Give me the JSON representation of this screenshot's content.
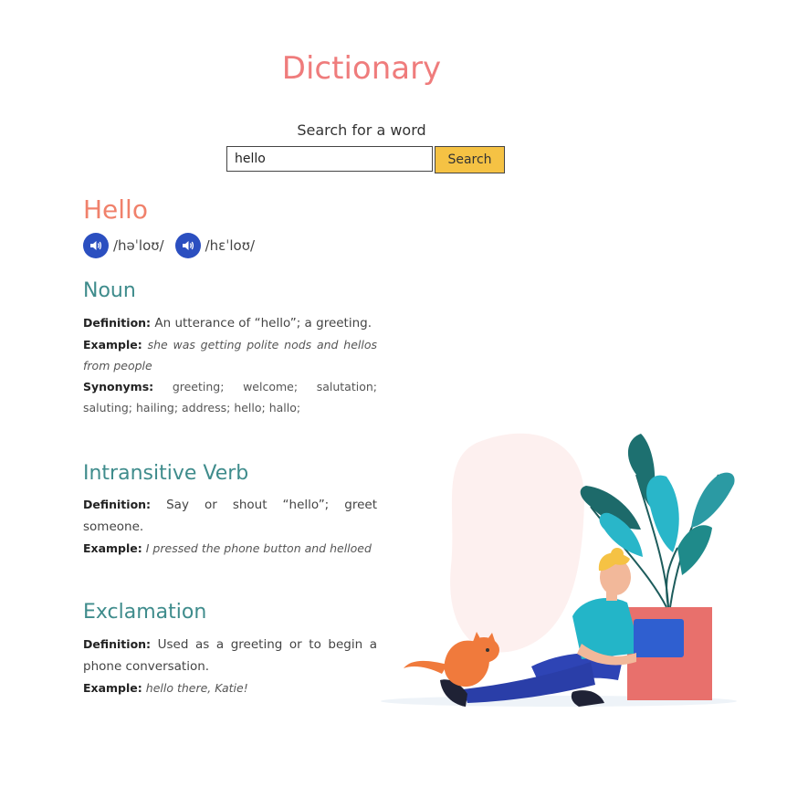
{
  "header": {
    "title": "Dictionary"
  },
  "search": {
    "prompt": "Search for a word",
    "value": "hello",
    "button_label": "Search"
  },
  "result": {
    "word": "Hello",
    "phonetics": [
      {
        "text": "/həˈloʊ/"
      },
      {
        "text": "/hɛˈloʊ/"
      }
    ],
    "meanings": [
      {
        "part_of_speech": "Noun",
        "definition_label": "Definition:",
        "definition": "An utterance of “hello”; a greeting.",
        "example_label": "Example:",
        "example": "she was getting polite nods and hellos from people",
        "synonyms_label": "Synonyms:",
        "synonyms": "greeting;  welcome;  salutation;  saluting;  hailing;  address;  hello;  hallo;"
      },
      {
        "part_of_speech": "Intransitive Verb",
        "definition_label": "Definition:",
        "definition": "Say or shout “hello”; greet someone.",
        "example_label": "Example:",
        "example": "I pressed the phone button and helloed"
      },
      {
        "part_of_speech": "Exclamation",
        "definition_label": "Definition:",
        "definition": "Used as a greeting or to begin a phone conversation.",
        "example_label": "Example:",
        "example": "hello there, Katie!"
      }
    ]
  },
  "colors": {
    "title": "#ef7c7c",
    "word": "#f0816b",
    "heading": "#3f8c8c",
    "search_button": "#f5c244",
    "audio_button": "#2b4fc0"
  },
  "icons": {
    "audio": "speaker-icon"
  }
}
